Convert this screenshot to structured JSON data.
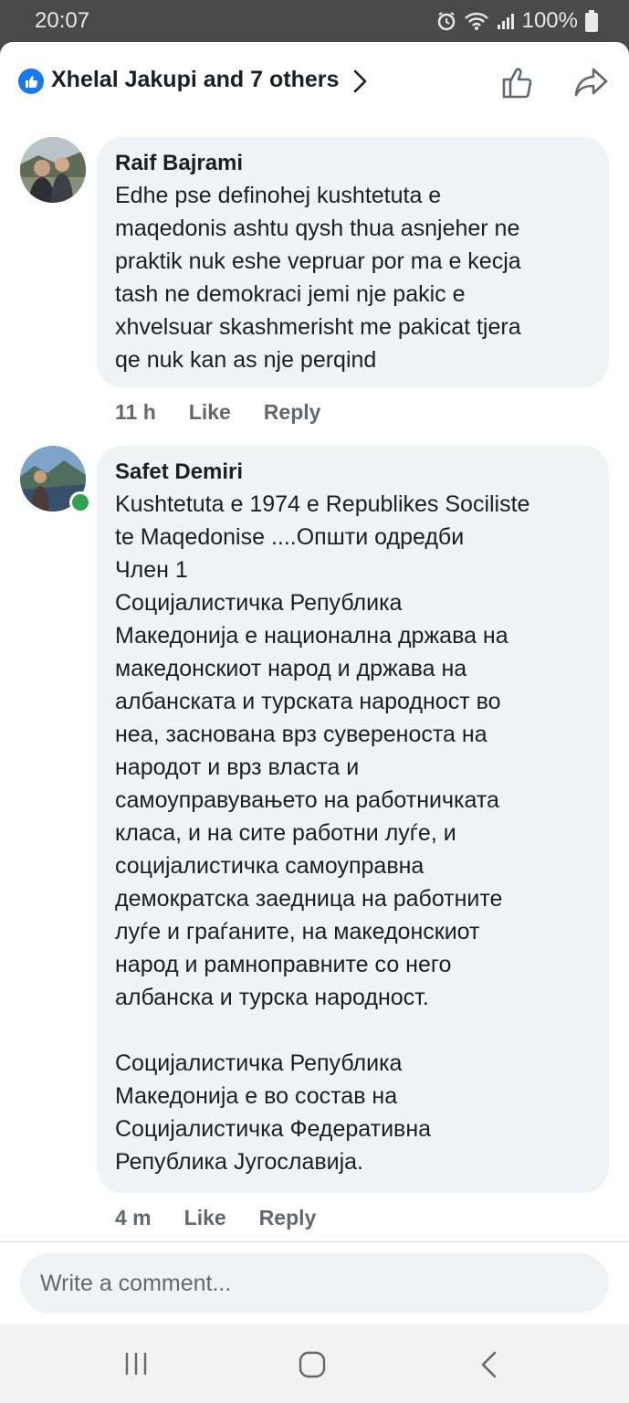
{
  "status_bar": {
    "time": "20:07",
    "battery": "100%",
    "icons": [
      "alarm-icon",
      "wifi-icon",
      "signal-icon",
      "battery-icon"
    ]
  },
  "reactions": {
    "text": "Xhelal Jakupi and 7 others",
    "icons": [
      "like-badge-icon",
      "chevron-right-icon",
      "thumbs-up-icon",
      "share-icon"
    ]
  },
  "comments": [
    {
      "author": "Raif Bajrami",
      "text": "Edhe pse definohej kushtetuta e\nmaqedonis ashtu qysh thua asnjeher ne\npraktik nuk eshe vepruar por ma e kecja\ntash ne demokraci jemi nje pakic e\nxhvelsuar skashmerisht me pakicat tjera\nqe nuk kan as nje perqind",
      "time": "11 h",
      "like_label": "Like",
      "reply_label": "Reply"
    },
    {
      "author": "Safet Demiri",
      "text": "Kushtetuta e 1974 e Republikes Sociliste\nte Maqedonise ....Општи одредби\nЧлен 1\nСоцијалистичка Република\nМакедонија е национална држава на\nмакедонскиот народ и држава на\nалбанската и турската народност во\nнеа, заснована врз суверeноста на\nнародот и врз власта и\nсамоуправувањето на работничката\nкласа, и на сите работни луѓе, и\nсоцијалистичка самоуправна\nдемократска заедница на работните\nлуѓе и граѓаните, на македонскиот\nнарод и рамноправните со него\nалбанска и турска народност.\n\nСоцијалистичка Република\nМакедонија е во состав на\nСоцијалистичка Федеративна\nРепублика Југославија.",
      "time": "4 m",
      "like_label": "Like",
      "reply_label": "Reply",
      "online": true
    }
  ],
  "composer": {
    "placeholder": "Write a comment..."
  },
  "colors": {
    "accent": "#1877f2",
    "bubble": "#f0f2f5",
    "meta_text": "#65676b",
    "online": "#31a24c"
  }
}
